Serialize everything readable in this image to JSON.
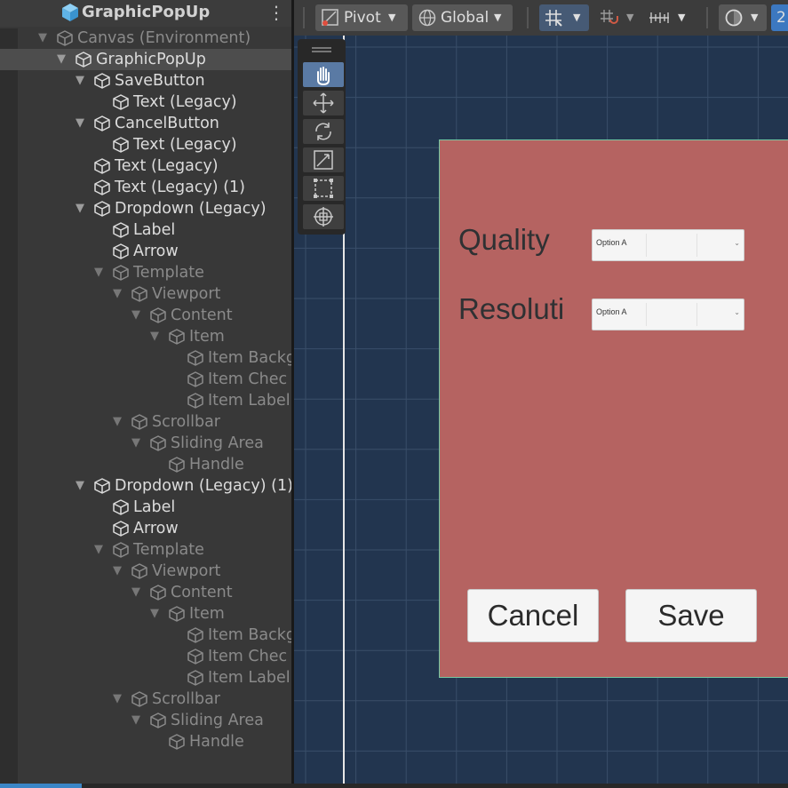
{
  "hierarchy": {
    "title": "GraphicPopUp",
    "rows": [
      {
        "label": "Canvas (Environment)",
        "depth": 0,
        "arrow": true,
        "dim": true,
        "sel": false
      },
      {
        "label": "GraphicPopUp",
        "depth": 1,
        "arrow": true,
        "dim": false,
        "sel": true
      },
      {
        "label": "SaveButton",
        "depth": 2,
        "arrow": true,
        "dim": false,
        "sel": false
      },
      {
        "label": "Text (Legacy)",
        "depth": 3,
        "arrow": false,
        "dim": false,
        "sel": false
      },
      {
        "label": "CancelButton",
        "depth": 2,
        "arrow": true,
        "dim": false,
        "sel": false
      },
      {
        "label": "Text (Legacy)",
        "depth": 3,
        "arrow": false,
        "dim": false,
        "sel": false
      },
      {
        "label": "Text (Legacy)",
        "depth": 2,
        "arrow": false,
        "dim": false,
        "sel": false
      },
      {
        "label": "Text (Legacy) (1)",
        "depth": 2,
        "arrow": false,
        "dim": false,
        "sel": false
      },
      {
        "label": "Dropdown (Legacy)",
        "depth": 2,
        "arrow": true,
        "dim": false,
        "sel": false
      },
      {
        "label": "Label",
        "depth": 3,
        "arrow": false,
        "dim": false,
        "sel": false
      },
      {
        "label": "Arrow",
        "depth": 3,
        "arrow": false,
        "dim": false,
        "sel": false
      },
      {
        "label": "Template",
        "depth": 3,
        "arrow": true,
        "dim": true,
        "sel": false
      },
      {
        "label": "Viewport",
        "depth": 4,
        "arrow": true,
        "dim": true,
        "sel": false
      },
      {
        "label": "Content",
        "depth": 5,
        "arrow": true,
        "dim": true,
        "sel": false
      },
      {
        "label": "Item",
        "depth": 6,
        "arrow": true,
        "dim": true,
        "sel": false
      },
      {
        "label": "Item Backg",
        "depth": 7,
        "arrow": false,
        "dim": true,
        "sel": false
      },
      {
        "label": "Item Chec",
        "depth": 7,
        "arrow": false,
        "dim": true,
        "sel": false
      },
      {
        "label": "Item Label",
        "depth": 7,
        "arrow": false,
        "dim": true,
        "sel": false
      },
      {
        "label": "Scrollbar",
        "depth": 4,
        "arrow": true,
        "dim": true,
        "sel": false
      },
      {
        "label": "Sliding Area",
        "depth": 5,
        "arrow": true,
        "dim": true,
        "sel": false
      },
      {
        "label": "Handle",
        "depth": 6,
        "arrow": false,
        "dim": true,
        "sel": false
      },
      {
        "label": "Dropdown (Legacy) (1)",
        "depth": 2,
        "arrow": true,
        "dim": false,
        "sel": false
      },
      {
        "label": "Label",
        "depth": 3,
        "arrow": false,
        "dim": false,
        "sel": false
      },
      {
        "label": "Arrow",
        "depth": 3,
        "arrow": false,
        "dim": false,
        "sel": false
      },
      {
        "label": "Template",
        "depth": 3,
        "arrow": true,
        "dim": true,
        "sel": false
      },
      {
        "label": "Viewport",
        "depth": 4,
        "arrow": true,
        "dim": true,
        "sel": false
      },
      {
        "label": "Content",
        "depth": 5,
        "arrow": true,
        "dim": true,
        "sel": false
      },
      {
        "label": "Item",
        "depth": 6,
        "arrow": true,
        "dim": true,
        "sel": false
      },
      {
        "label": "Item Backg",
        "depth": 7,
        "arrow": false,
        "dim": true,
        "sel": false
      },
      {
        "label": "Item Chec",
        "depth": 7,
        "arrow": false,
        "dim": true,
        "sel": false
      },
      {
        "label": "Item Label",
        "depth": 7,
        "arrow": false,
        "dim": true,
        "sel": false
      },
      {
        "label": "Scrollbar",
        "depth": 4,
        "arrow": true,
        "dim": true,
        "sel": false
      },
      {
        "label": "Sliding Area",
        "depth": 5,
        "arrow": true,
        "dim": true,
        "sel": false
      },
      {
        "label": "Handle",
        "depth": 6,
        "arrow": false,
        "dim": true,
        "sel": false
      }
    ]
  },
  "toolbar": {
    "pivot_label": "Pivot",
    "global_label": "Global",
    "last_label": "2"
  },
  "popup": {
    "quality_label": "Quality",
    "resolution_label": "Resoluti",
    "quality_dropdown_value": "Option A",
    "resolution_dropdown_value": "Option A",
    "cancel_label": "Cancel",
    "save_label": "Save"
  },
  "colors": {
    "panel": "#b56361",
    "scene_bg": "#22354f",
    "selection_accent": "#3b86c7"
  },
  "icons": [
    "unity-cube-icon",
    "kebab-menu-icon",
    "pivot-icon",
    "globe-icon",
    "grid-snap-icon",
    "snap-increment-icon",
    "ruler-icon",
    "gizmo-sphere-icon",
    "hand-tool-icon",
    "move-tool-icon",
    "rotate-tool-icon",
    "scale-tool-icon",
    "rect-tool-icon",
    "transform-tool-icon"
  ]
}
